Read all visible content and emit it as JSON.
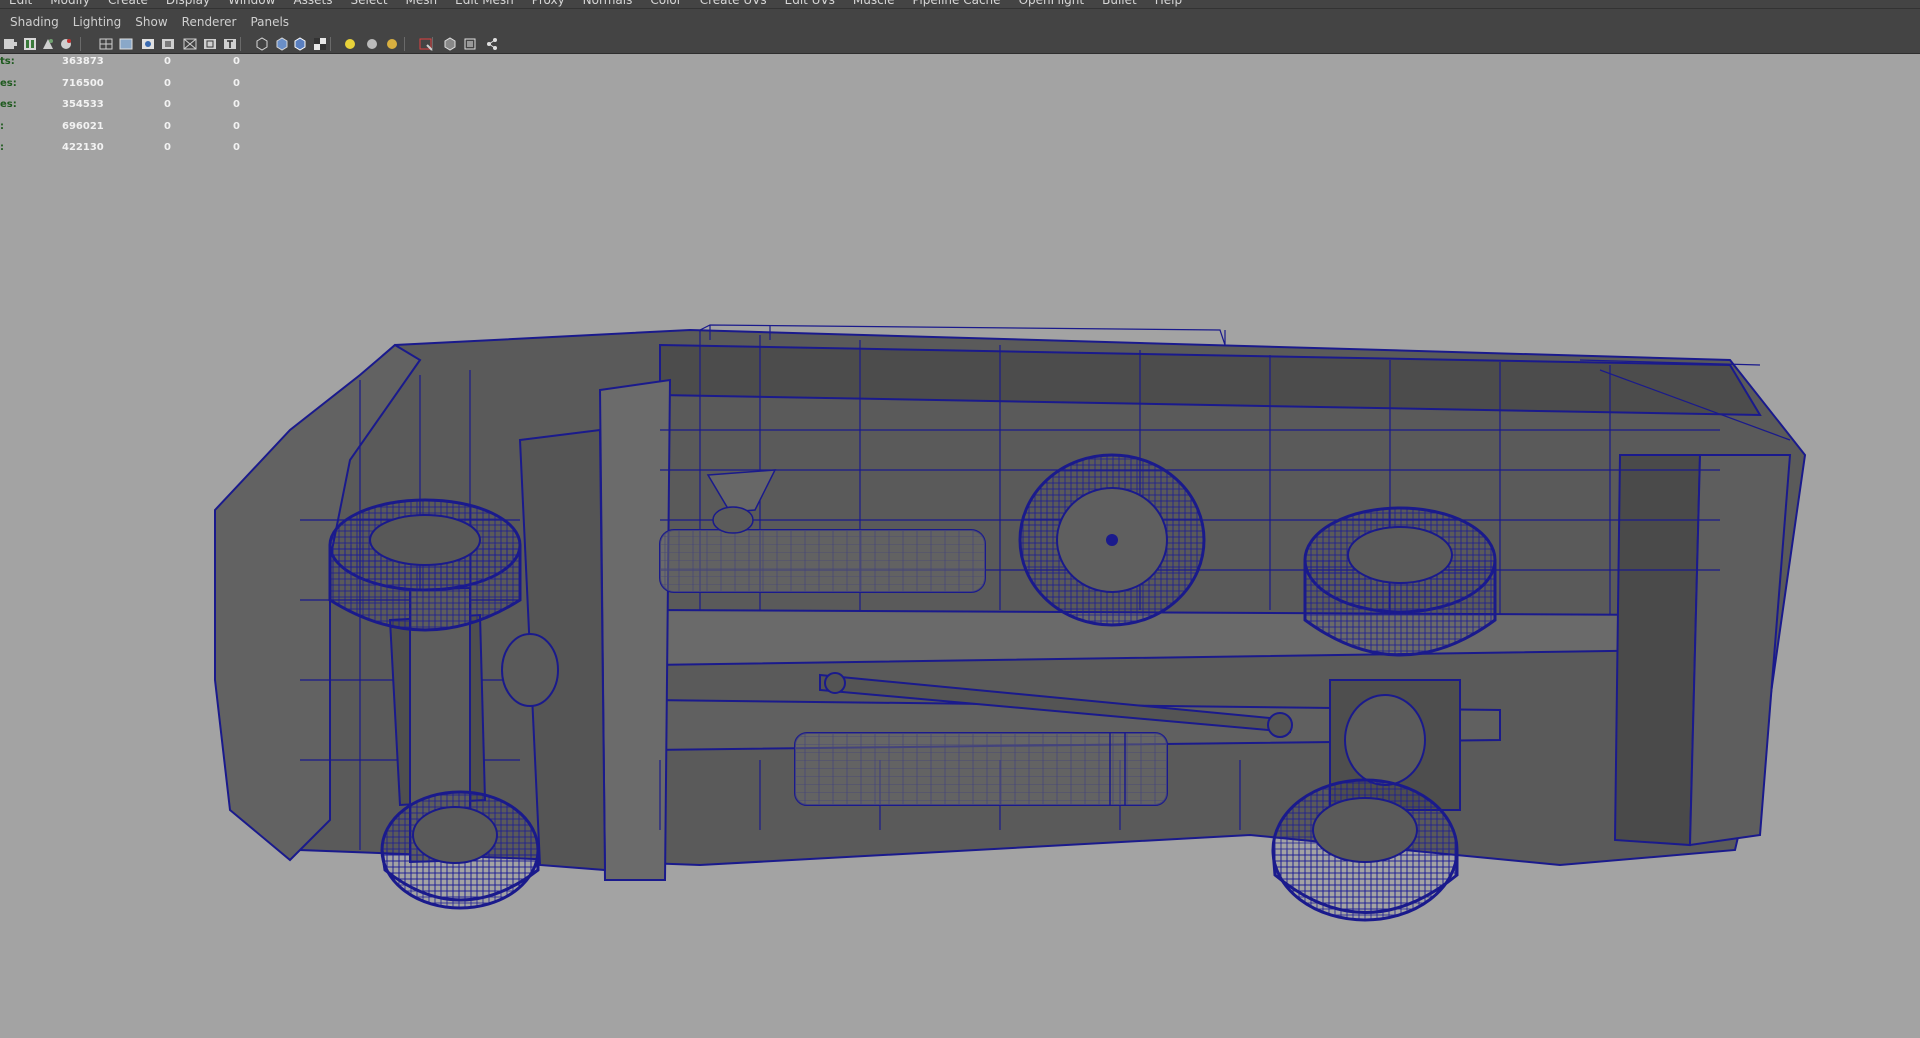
{
  "main_menu": {
    "items": [
      "Edit",
      "Modify",
      "Create",
      "Display",
      "Window",
      "Assets",
      "Select",
      "Mesh",
      "Edit Mesh",
      "Proxy",
      "Normals",
      "Color",
      "Create UVs",
      "Edit UVs",
      "Muscle",
      "Pipeline Cache",
      "OpenFlight",
      "Bullet",
      "Help"
    ]
  },
  "panel_menu": {
    "items": [
      "Shading",
      "Lighting",
      "Show",
      "Renderer",
      "Panels"
    ]
  },
  "toolbar": {
    "icons": [
      "select-camera-icon",
      "camera-attributes-icon",
      "bookmark-icon",
      "image-plane-icon",
      "grid-icon",
      "film-gate-icon",
      "resolution-gate-icon",
      "gate-mask-icon",
      "field-chart-icon",
      "safe-action-icon",
      "safe-title-icon",
      "wireframe-icon",
      "smooth-shade-icon",
      "wireframe-on-shaded-icon",
      "textured-icon",
      "use-all-lights-icon",
      "shadows-icon",
      "ambient-occlusion-icon",
      "isolate-select-icon",
      "xray-icon",
      "xray-joints-icon",
      "xray-components-icon"
    ]
  },
  "hud": {
    "rows": [
      {
        "label": "ts:",
        "v1": "363873",
        "v2": "0",
        "v3": "0"
      },
      {
        "label": "es:",
        "v1": "716500",
        "v2": "0",
        "v3": "0"
      },
      {
        "label": "es:",
        "v1": "354533",
        "v2": "0",
        "v3": "0"
      },
      {
        "label": ":",
        "v1": "696021",
        "v2": "0",
        "v3": "0"
      },
      {
        "label": ":",
        "v1": "422130",
        "v2": "0",
        "v3": "0"
      }
    ]
  },
  "viewport": {
    "background_color": "#a3a3a3",
    "wire_color": "#1a1a8c",
    "shade_color": "#5b5b5b",
    "subject": "truck-chassis-wireframe-model"
  }
}
